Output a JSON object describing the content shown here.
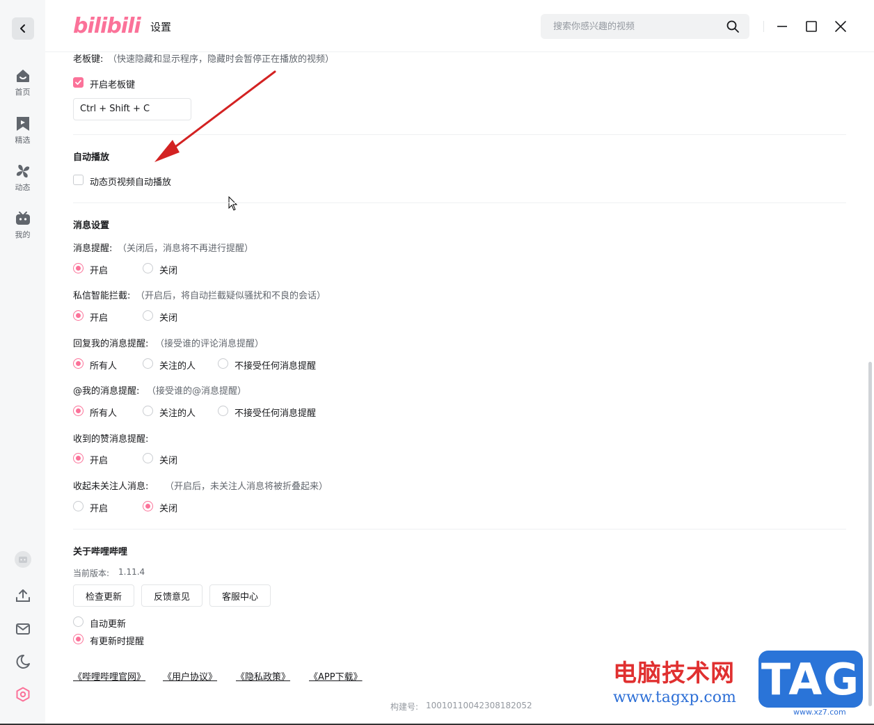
{
  "header": {
    "logo": "bilibili",
    "title": "设置",
    "search_placeholder": "搜索你感兴趣的视频"
  },
  "sidebar": {
    "items": [
      {
        "label": "首页",
        "icon": "home-icon"
      },
      {
        "label": "精选",
        "icon": "bookmark-icon"
      },
      {
        "label": "动态",
        "icon": "pinwheel-icon"
      },
      {
        "label": "我的",
        "icon": "tv-icon"
      }
    ],
    "bottom_icons": [
      "avatar-icon",
      "upload-icon",
      "mail-icon",
      "theme-moon-icon",
      "settings-icon"
    ]
  },
  "boss_key": {
    "label": "老板键:",
    "desc": "（快速隐藏和显示程序，隐藏时会暂停正在播放的视频）",
    "checkbox_label": "开启老板键",
    "checked": true,
    "hotkey": "Ctrl + Shift + C"
  },
  "autoplay": {
    "heading": "自动播放",
    "checkbox_label": "动态页视频自动播放",
    "checked": false
  },
  "messages": {
    "heading": "消息设置",
    "groups": [
      {
        "label": "消息提醒:",
        "desc": "（关闭后，消息将不再进行提醒）",
        "options": [
          "开启",
          "关闭"
        ],
        "selected": 0
      },
      {
        "label": "私信智能拦截:",
        "desc": "（开启后，将自动拦截疑似骚扰和不良的会话）",
        "options": [
          "开启",
          "关闭"
        ],
        "selected": 0
      },
      {
        "label": "回复我的消息提醒:",
        "desc": "（接受谁的评论消息提醒）",
        "options": [
          "所有人",
          "关注的人",
          "不接受任何消息提醒"
        ],
        "selected": 0
      },
      {
        "label": "@我的消息提醒:",
        "desc": "（接受谁的@消息提醒）",
        "options": [
          "所有人",
          "关注的人",
          "不接受任何消息提醒"
        ],
        "selected": 0
      },
      {
        "label": "收到的赞消息提醒:",
        "desc": "",
        "options": [
          "开启",
          "关闭"
        ],
        "selected": 0
      },
      {
        "label": "收起未关注人消息:",
        "desc": "（开启后，未关注人消息将被折叠起来）",
        "options": [
          "开启",
          "关闭"
        ],
        "selected": 1
      }
    ]
  },
  "about": {
    "heading": "关于哔哩哔哩",
    "version_label": "当前版本:",
    "version": "1.11.4",
    "buttons": [
      "检查更新",
      "反馈意见",
      "客服中心"
    ],
    "update_options": [
      "自动更新",
      "有更新时提醒"
    ],
    "update_selected": 1,
    "links": [
      "《哔哩哔哩官网》",
      "《用户协议》",
      "《隐私政策》",
      "《APP下载》"
    ],
    "build_label": "构建号:",
    "build": "10010110042308182052"
  },
  "watermark": {
    "cn": "电脑技术网",
    "url": "www.tagxp.com",
    "tag": "TAG",
    "sub": "www.xz7.com"
  },
  "colors": {
    "accent": "#fb7299",
    "annotation_arrow": "#d32222"
  }
}
